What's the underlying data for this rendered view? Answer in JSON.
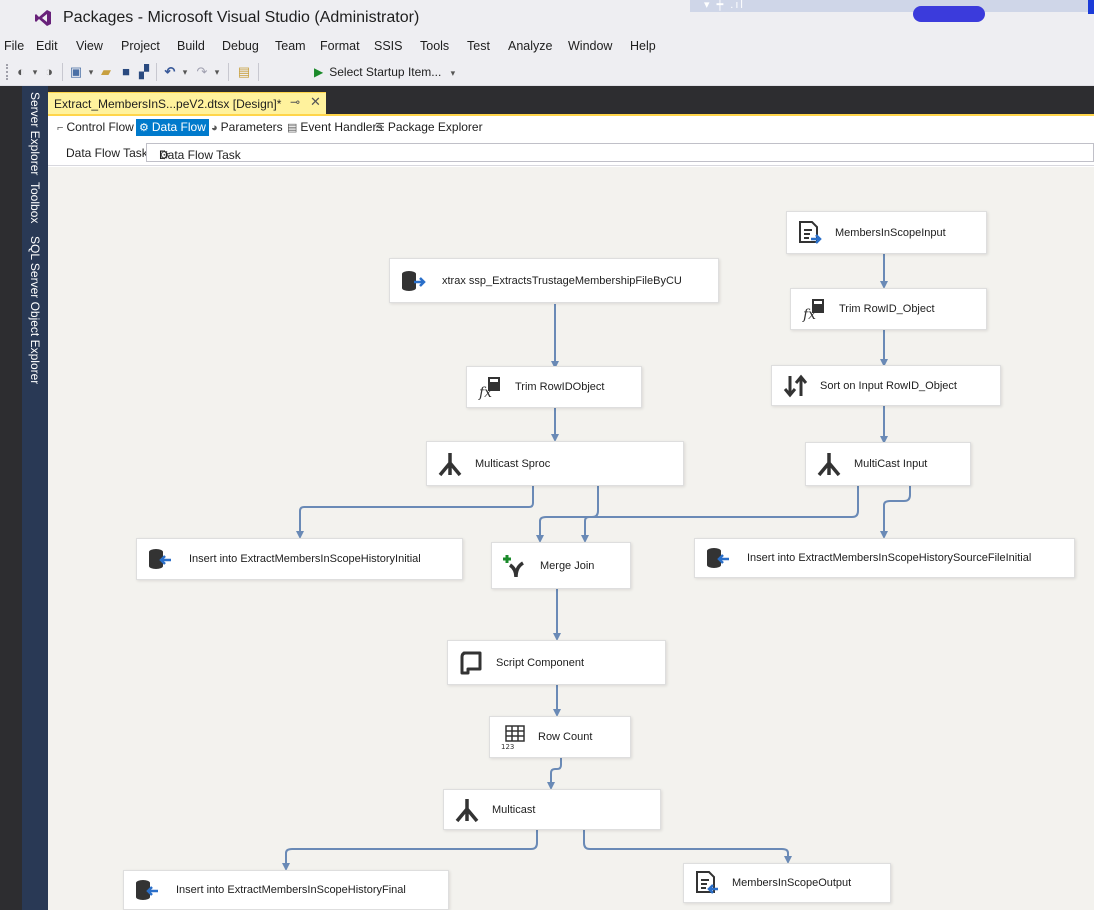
{
  "window": {
    "title": "Packages - Microsoft Visual Studio  (Administrator)"
  },
  "menu": [
    "File",
    "Edit",
    "View",
    "Project",
    "Build",
    "Debug",
    "Team",
    "Format",
    "SSIS",
    "Tools",
    "Test",
    "Analyze",
    "Window",
    "Help"
  ],
  "toolbar": {
    "startup_label": "Select Startup Item..."
  },
  "side_panel": [
    "Server Explorer",
    "Toolbox",
    "SQL Server Object Explorer"
  ],
  "document_tab": {
    "title": "Extract_MembersInS...peV2.dtsx [Design]*"
  },
  "designer_tabs": [
    {
      "label": "Control Flow",
      "active": false
    },
    {
      "label": "Data Flow",
      "active": true
    },
    {
      "label": "Parameters",
      "active": false
    },
    {
      "label": "Event Handlers",
      "active": false
    },
    {
      "label": "Package Explorer",
      "active": false
    }
  ],
  "task": {
    "label": "Data Flow Task:",
    "selected": "Data Flow Task"
  },
  "colors": {
    "accent": "#007acc",
    "tab_highlight": "#fff29d",
    "canvas": "#f3f2ee",
    "connector": "#6a8ab6"
  },
  "components": {
    "members_in_scope_input": {
      "label": "MembersInScopeInput",
      "icon": "flat-file-source-icon"
    },
    "xtrax_sproc": {
      "label": "xtrax ssp_ExtractsTrustageMembershipFileByCU",
      "icon": "ole-db-source-icon"
    },
    "trim_rowid_object_input": {
      "label": "Trim RowID_Object",
      "icon": "derived-column-icon"
    },
    "trim_rowidobject_sproc": {
      "label": "Trim RowIDObject",
      "icon": "derived-column-icon"
    },
    "sort_on_input": {
      "label": "Sort on Input RowID_Object",
      "icon": "sort-icon"
    },
    "multicast_sproc": {
      "label": "Multicast Sproc",
      "icon": "multicast-icon"
    },
    "multicast_input": {
      "label": "MultiCast Input",
      "icon": "multicast-icon"
    },
    "insert_history_initial": {
      "label": "Insert into ExtractMembersInScopeHistoryInitial",
      "icon": "ole-db-destination-icon"
    },
    "merge_join": {
      "label": "Merge Join",
      "icon": "merge-join-icon"
    },
    "insert_history_source_file_initial": {
      "label": "Insert into ExtractMembersInScopeHistorySourceFileInitial",
      "icon": "ole-db-destination-icon"
    },
    "script_component": {
      "label": "Script Component",
      "icon": "script-component-icon"
    },
    "row_count": {
      "label": "Row Count",
      "icon": "row-count-icon"
    },
    "multicast": {
      "label": "Multicast",
      "icon": "multicast-icon"
    },
    "insert_history_final": {
      "label": "Insert into ExtractMembersInScopeHistoryFinal",
      "icon": "ole-db-destination-icon"
    },
    "members_in_scope_output": {
      "label": "MembersInScopeOutput",
      "icon": "flat-file-destination-icon"
    }
  }
}
